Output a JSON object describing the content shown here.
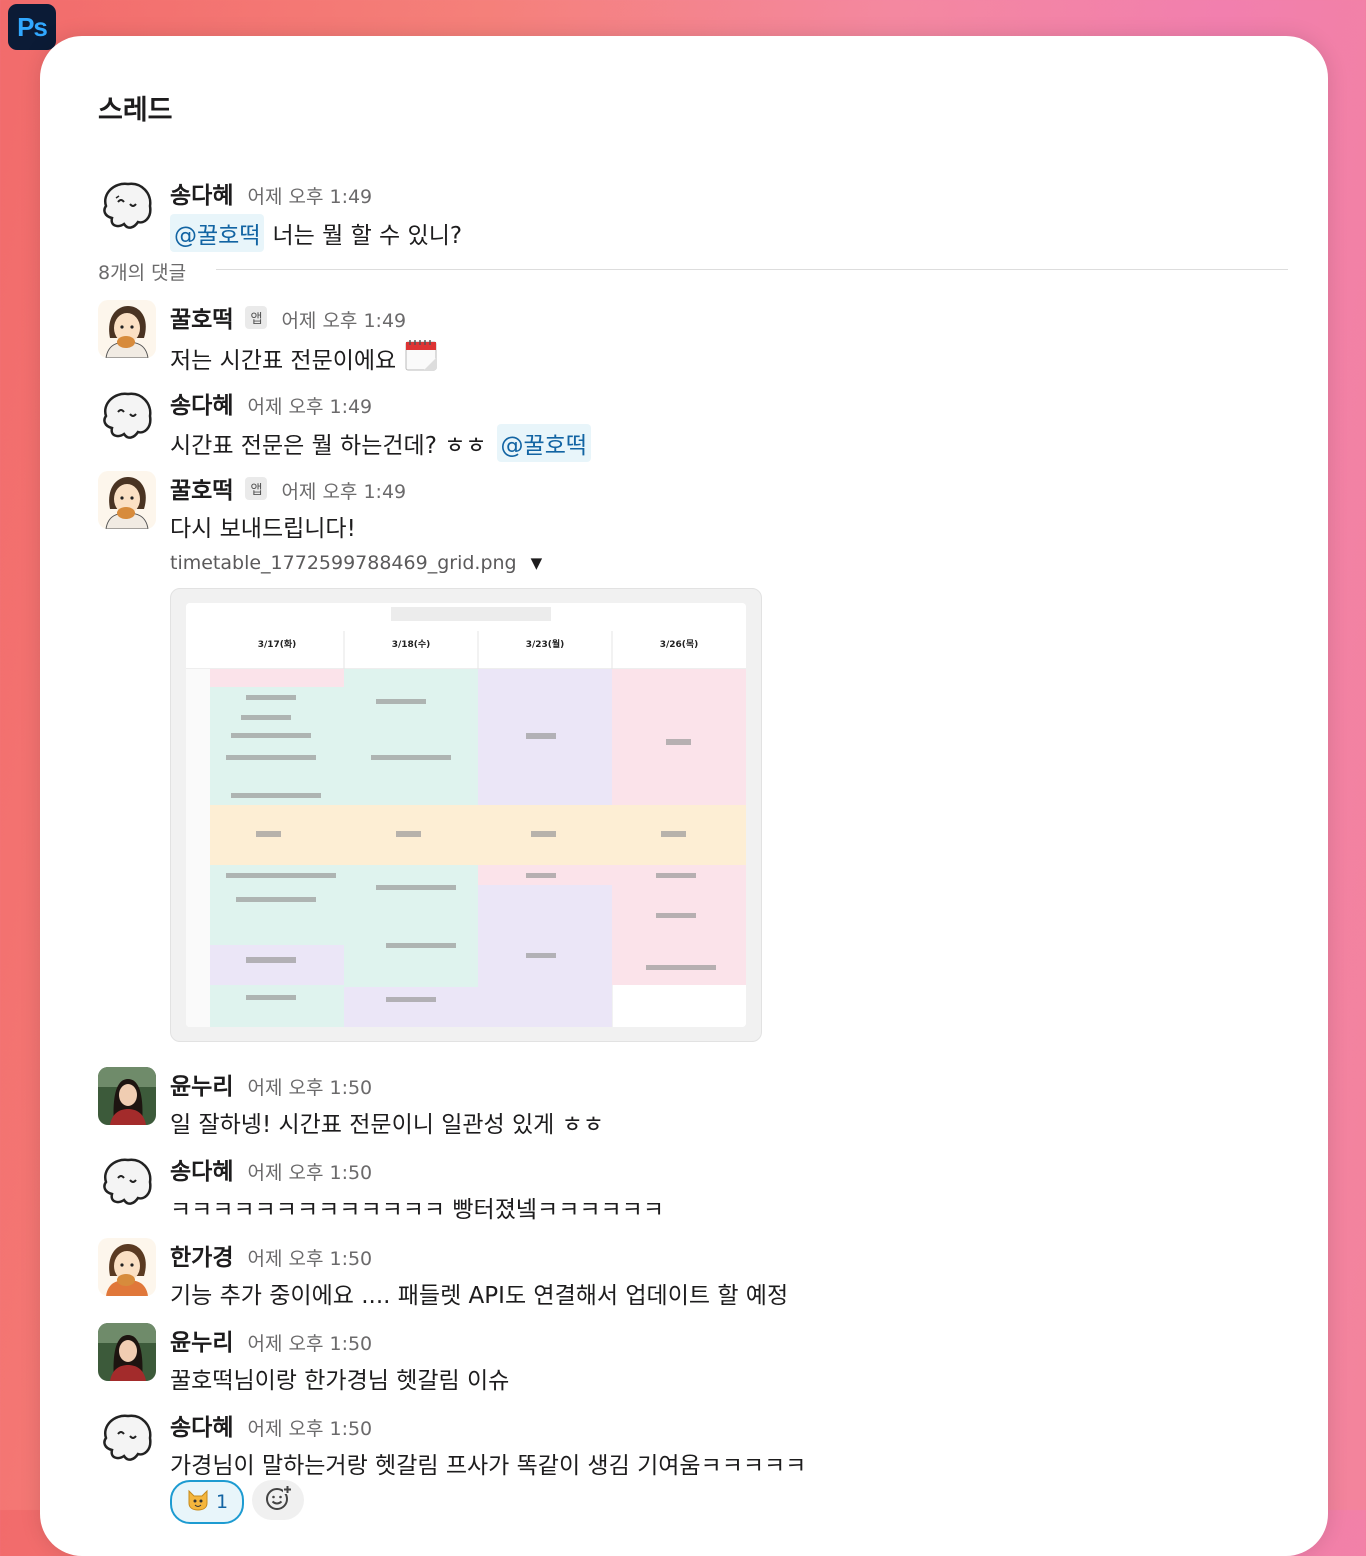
{
  "app_icon": {
    "label": "Ps",
    "color": "#31a8ff"
  },
  "thread": {
    "title": "스레드",
    "reply_count_label": "8개의 댓글"
  },
  "messages": [
    {
      "author": "송다혜",
      "time": "어제 오후 1:49",
      "mention": "@꿀호떡",
      "text": "너는 뭘 할 수 있니?",
      "avatar": "ghost-avatar"
    },
    {
      "author": "꿀호떡",
      "badge": "앱",
      "time": "어제 오후 1:49",
      "text": "저는 시간표 전문이에요",
      "emoji": "calendar-icon",
      "avatar": "girl-avatar"
    },
    {
      "author": "송다혜",
      "time": "어제 오후 1:49",
      "text": "시간표 전문은 뭘 하는건데? ㅎㅎ",
      "mention": "@꿀호떡",
      "avatar": "ghost-avatar"
    },
    {
      "author": "꿀호떡",
      "badge": "앱",
      "time": "어제 오후 1:49",
      "text": "다시 보내드립니다!",
      "avatar": "girl-avatar"
    },
    {
      "author": "윤누리",
      "time": "어제 오후 1:50",
      "text": "일 잘하넹! 시간표 전문이니 일관성 있게 ㅎㅎ",
      "avatar": "photo-avatar"
    },
    {
      "author": "송다혜",
      "time": "어제 오후 1:50",
      "text": "ㅋㅋㅋㅋㅋㅋㅋㅋㅋㅋㅋㅋㅋ 빵터졌넼ㅋㅋㅋㅋㅋㅋ",
      "avatar": "ghost-avatar"
    },
    {
      "author": "한가경",
      "time": "어제 오후 1:50",
      "text": "기능 추가 중이에요 .... 패들렛 API도 연결해서 업데이트 할 예정",
      "avatar": "girl-avatar"
    },
    {
      "author": "윤누리",
      "time": "어제 오후 1:50",
      "text": "꿀호떡님이랑 한가경님 헷갈림 이슈",
      "avatar": "photo-avatar"
    },
    {
      "author": "송다혜",
      "time": "어제 오후 1:50",
      "text": "가경님이 말하는거랑 헷갈림 프사가 똑같이 생김 기여움ㅋㅋㅋㅋㅋ",
      "avatar": "ghost-avatar"
    }
  ],
  "attachment": {
    "file_name": "timetable_1772599788469_grid.png",
    "columns": [
      "3/17(화)",
      "3/18(수)",
      "3/23(월)",
      "3/26(목)"
    ]
  },
  "reaction": {
    "emoji": "cat-face-icon",
    "count": "1"
  },
  "colors": {
    "mention_bg": "#e8f5fa",
    "mention_text": "#1264a3",
    "green_cell": "#dff3ee",
    "purple_cell": "#ebe6f7",
    "pink_cell": "#fbe3ea",
    "orange_cell": "#fdeed4"
  }
}
